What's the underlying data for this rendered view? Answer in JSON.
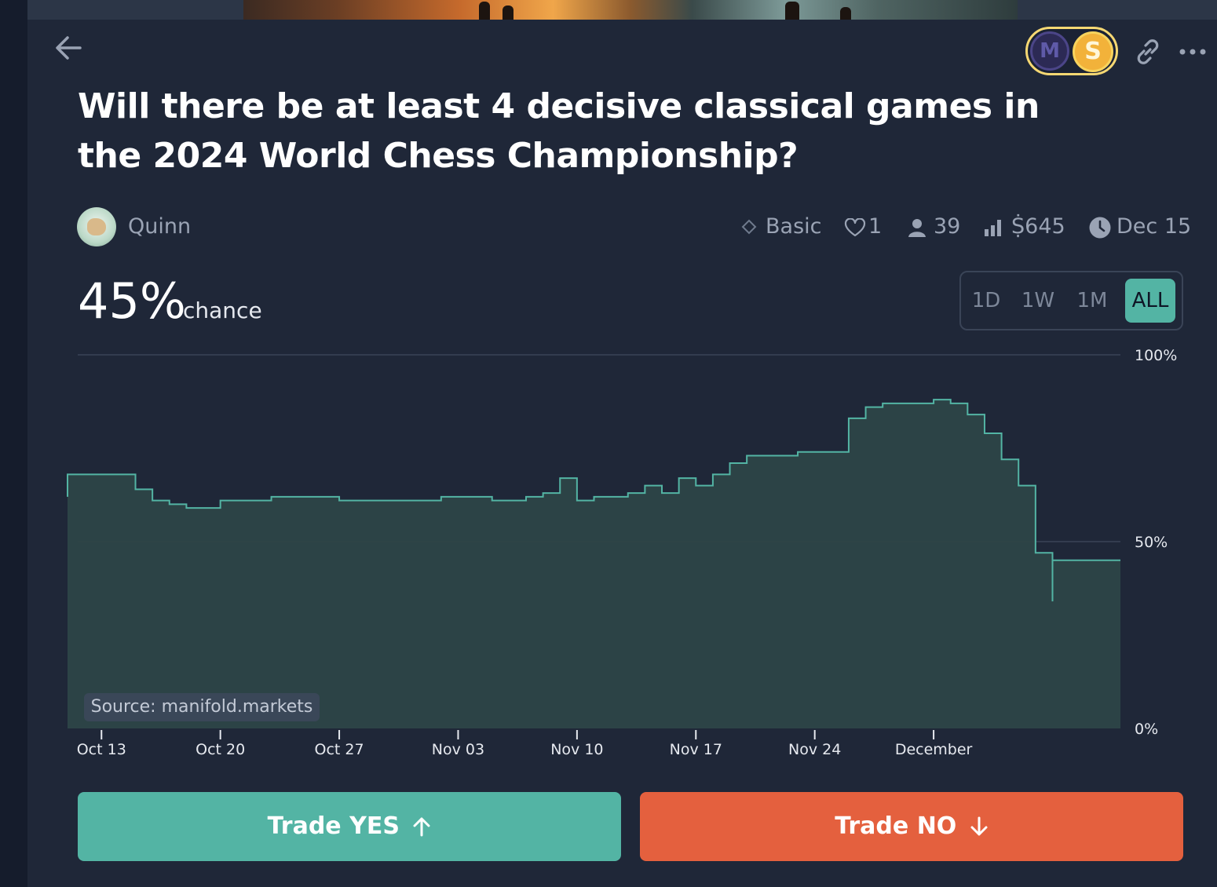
{
  "market": {
    "title": "Will there be at least 4 decisive classical games in the 2024 World Chess Championship?",
    "author": "Quinn",
    "tier": "Basic",
    "likes": "1",
    "traders": "39",
    "volume": "Ṩ645",
    "close_date": "Dec 15",
    "probability": "45%",
    "probability_label": "chance",
    "source": "Source: manifold.markets"
  },
  "badges": {
    "mana": "M",
    "sweepcash": "S"
  },
  "time_ranges": [
    {
      "label": "1D",
      "active": false
    },
    {
      "label": "1W",
      "active": false
    },
    {
      "label": "1M",
      "active": false
    },
    {
      "label": "ALL",
      "active": true
    }
  ],
  "actions": {
    "yes_label": "Trade YES",
    "no_label": "Trade NO"
  },
  "icons": {
    "back": "arrow-left-icon",
    "link": "link-icon",
    "more": "ellipsis-icon",
    "tier": "diamond-icon",
    "likes": "heart-icon",
    "traders": "user-icon",
    "volume": "bar-chart-icon",
    "close": "clock-icon",
    "yes": "arrow-up-icon",
    "no": "arrow-down-icon"
  },
  "colors": {
    "background": "#1f2738",
    "line": "#53b4a4",
    "fill": "#2d4447",
    "yes": "#53b4a4",
    "no": "#e4603e",
    "badge_border": "#f6d873"
  },
  "chart_data": {
    "type": "area",
    "step": true,
    "xlim": [
      "2024-10-11",
      "2024-12-12"
    ],
    "ylim": [
      0,
      100
    ],
    "y_ticks": [
      "100%",
      "50%",
      "0%"
    ],
    "x_ticks": [
      "Oct 13",
      "Oct 20",
      "Oct 27",
      "Nov 03",
      "Nov 10",
      "Nov 17",
      "Nov 24",
      "December"
    ],
    "grid": true,
    "series": [
      {
        "points": [
          [
            "2024-10-11",
            68
          ],
          [
            "2024-10-11",
            62
          ],
          [
            "2024-10-11",
            68
          ],
          [
            "2024-10-14",
            68
          ],
          [
            "2024-10-15",
            64
          ],
          [
            "2024-10-16",
            61
          ],
          [
            "2024-10-17",
            60
          ],
          [
            "2024-10-18",
            59
          ],
          [
            "2024-10-20",
            61
          ],
          [
            "2024-10-23",
            62
          ],
          [
            "2024-10-26",
            62
          ],
          [
            "2024-10-27",
            61
          ],
          [
            "2024-10-31",
            61
          ],
          [
            "2024-11-02",
            62
          ],
          [
            "2024-11-05",
            61
          ],
          [
            "2024-11-07",
            62
          ],
          [
            "2024-11-08",
            63
          ],
          [
            "2024-11-09",
            67
          ],
          [
            "2024-11-10",
            61
          ],
          [
            "2024-11-11",
            62
          ],
          [
            "2024-11-13",
            63
          ],
          [
            "2024-11-14",
            65
          ],
          [
            "2024-11-15",
            63
          ],
          [
            "2024-11-16",
            67
          ],
          [
            "2024-11-17",
            65
          ],
          [
            "2024-11-18",
            68
          ],
          [
            "2024-11-19",
            71
          ],
          [
            "2024-11-20",
            73
          ],
          [
            "2024-11-22",
            73
          ],
          [
            "2024-11-23",
            74
          ],
          [
            "2024-11-25",
            74
          ],
          [
            "2024-11-26",
            83
          ],
          [
            "2024-11-27",
            86
          ],
          [
            "2024-11-28",
            87
          ],
          [
            "2024-12-01",
            88
          ],
          [
            "2024-12-02",
            87
          ],
          [
            "2024-12-03",
            84
          ],
          [
            "2024-12-04",
            79
          ],
          [
            "2024-12-05",
            72
          ],
          [
            "2024-12-06",
            65
          ],
          [
            "2024-12-07",
            52
          ],
          [
            "2024-12-07",
            47
          ],
          [
            "2024-12-08",
            46
          ],
          [
            "2024-12-08",
            34
          ],
          [
            "2024-12-08",
            45
          ]
        ]
      }
    ]
  }
}
